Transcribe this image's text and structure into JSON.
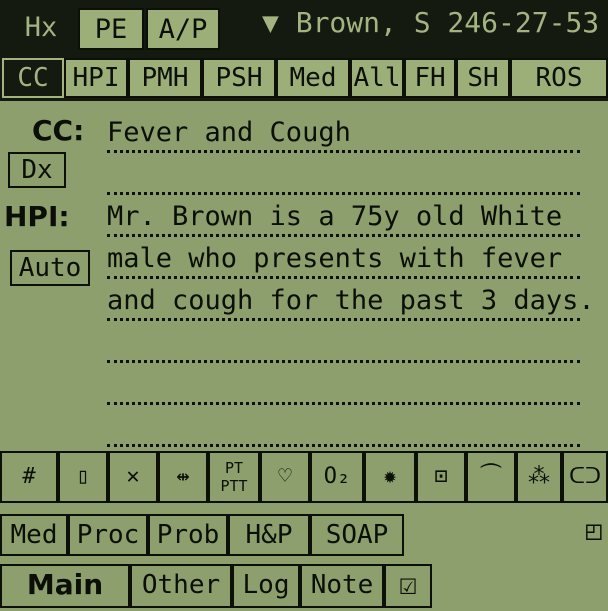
{
  "top_tabs": [
    {
      "label": "Hx",
      "selected": true
    },
    {
      "label": "PE",
      "selected": false
    },
    {
      "label": "A/P",
      "selected": false
    }
  ],
  "patient_selector": {
    "arrow_icon": "triangle-down-icon",
    "label": "Brown, S 246-27-53"
  },
  "section_tabs": [
    "CC",
    "HPI",
    "PMH",
    "PSH",
    "Med",
    "All",
    "FH",
    "SH",
    "ROS"
  ],
  "cc": {
    "label": "CC:",
    "lines": [
      "Fever and Cough",
      ""
    ]
  },
  "dx_button": "Dx",
  "hpi": {
    "label": "HPI:",
    "lines": [
      "Mr. Brown is a 75y old  White",
      "male who presents with fever",
      "and cough for the past 3 days.",
      "",
      "",
      ""
    ]
  },
  "auto_button": "Auto",
  "toolbar_icons": [
    {
      "icon": "calculator-icon",
      "glyph": "#"
    },
    {
      "icon": "vial-icon",
      "glyph": "▯"
    },
    {
      "icon": "cross-icon",
      "glyph": "✕"
    },
    {
      "icon": "arrows-inward-icon",
      "glyph": "⇹"
    },
    {
      "icon": "pt-ptt-icon",
      "glyph": "PT"
    },
    {
      "icon": "heart-icon",
      "glyph": "♡"
    },
    {
      "icon": "oxygen-icon",
      "glyph": "O₂"
    },
    {
      "icon": "bacteria-icon",
      "glyph": "✹"
    },
    {
      "icon": "kit-icon",
      "glyph": "⊡"
    },
    {
      "icon": "pulse-icon",
      "glyph": "⏜"
    },
    {
      "icon": "xray-icon",
      "glyph": "⁂"
    },
    {
      "icon": "lungs-icon",
      "glyph": "ᑕᑐ"
    }
  ],
  "tool_pt_sub": "PTT",
  "module_row1": [
    "Med",
    "Proc",
    "Prob",
    "H&P",
    "SOAP"
  ],
  "module_row2": [
    "Main",
    "Other",
    "Log",
    "Note"
  ],
  "checkbox_icon": "checkbox-checked-icon",
  "checkbox_glyph": "☑",
  "corner_icon": "page-corner-icon",
  "corner_glyph": "◰"
}
